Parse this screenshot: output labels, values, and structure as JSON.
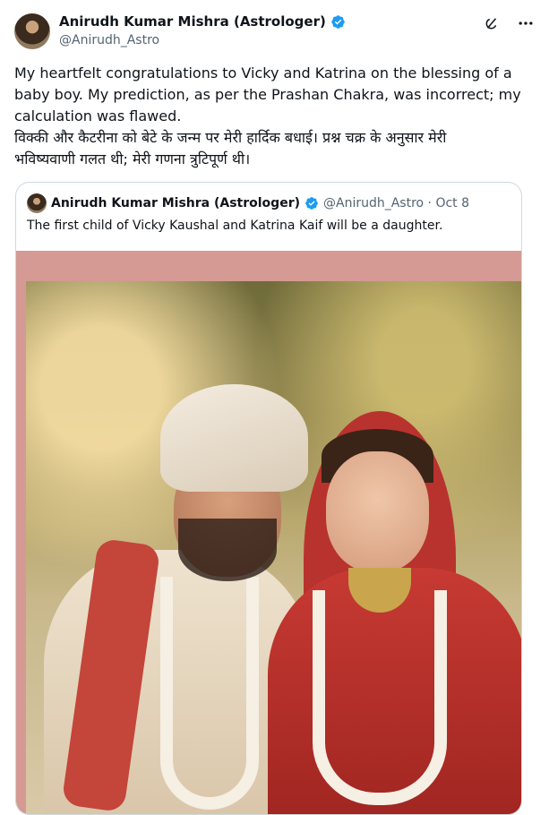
{
  "author": {
    "name": "Anirudh Kumar Mishra (Astrologer)",
    "handle": "@Anirudh_Astro",
    "verified_color": "#1d9bf0"
  },
  "icons": {
    "grok": "grok-icon",
    "more": "more-icon"
  },
  "tweet": {
    "text": "My heartfelt congratulations to Vicky and Katrina on the blessing of a\nbaby boy. My prediction, as per the Prashan Chakra, was incorrect; my\ncalculation was flawed.\nविक्की और कैटरीना को बेटे के जन्म पर मेरी हार्दिक बधाई। प्रश्न चक्र के अनुसार मेरी\nभविष्यवाणी गलत थी; मेरी गणना त्रुटिपूर्ण थी।"
  },
  "quoted": {
    "name": "Anirudh Kumar Mishra (Astrologer)",
    "handle_date": "@Anirudh_Astro · Oct 8",
    "text": "The first child of Vicky Kaushal and Katrina Kaif will be a daughter.",
    "photo_frame_color": "#d49a93"
  }
}
